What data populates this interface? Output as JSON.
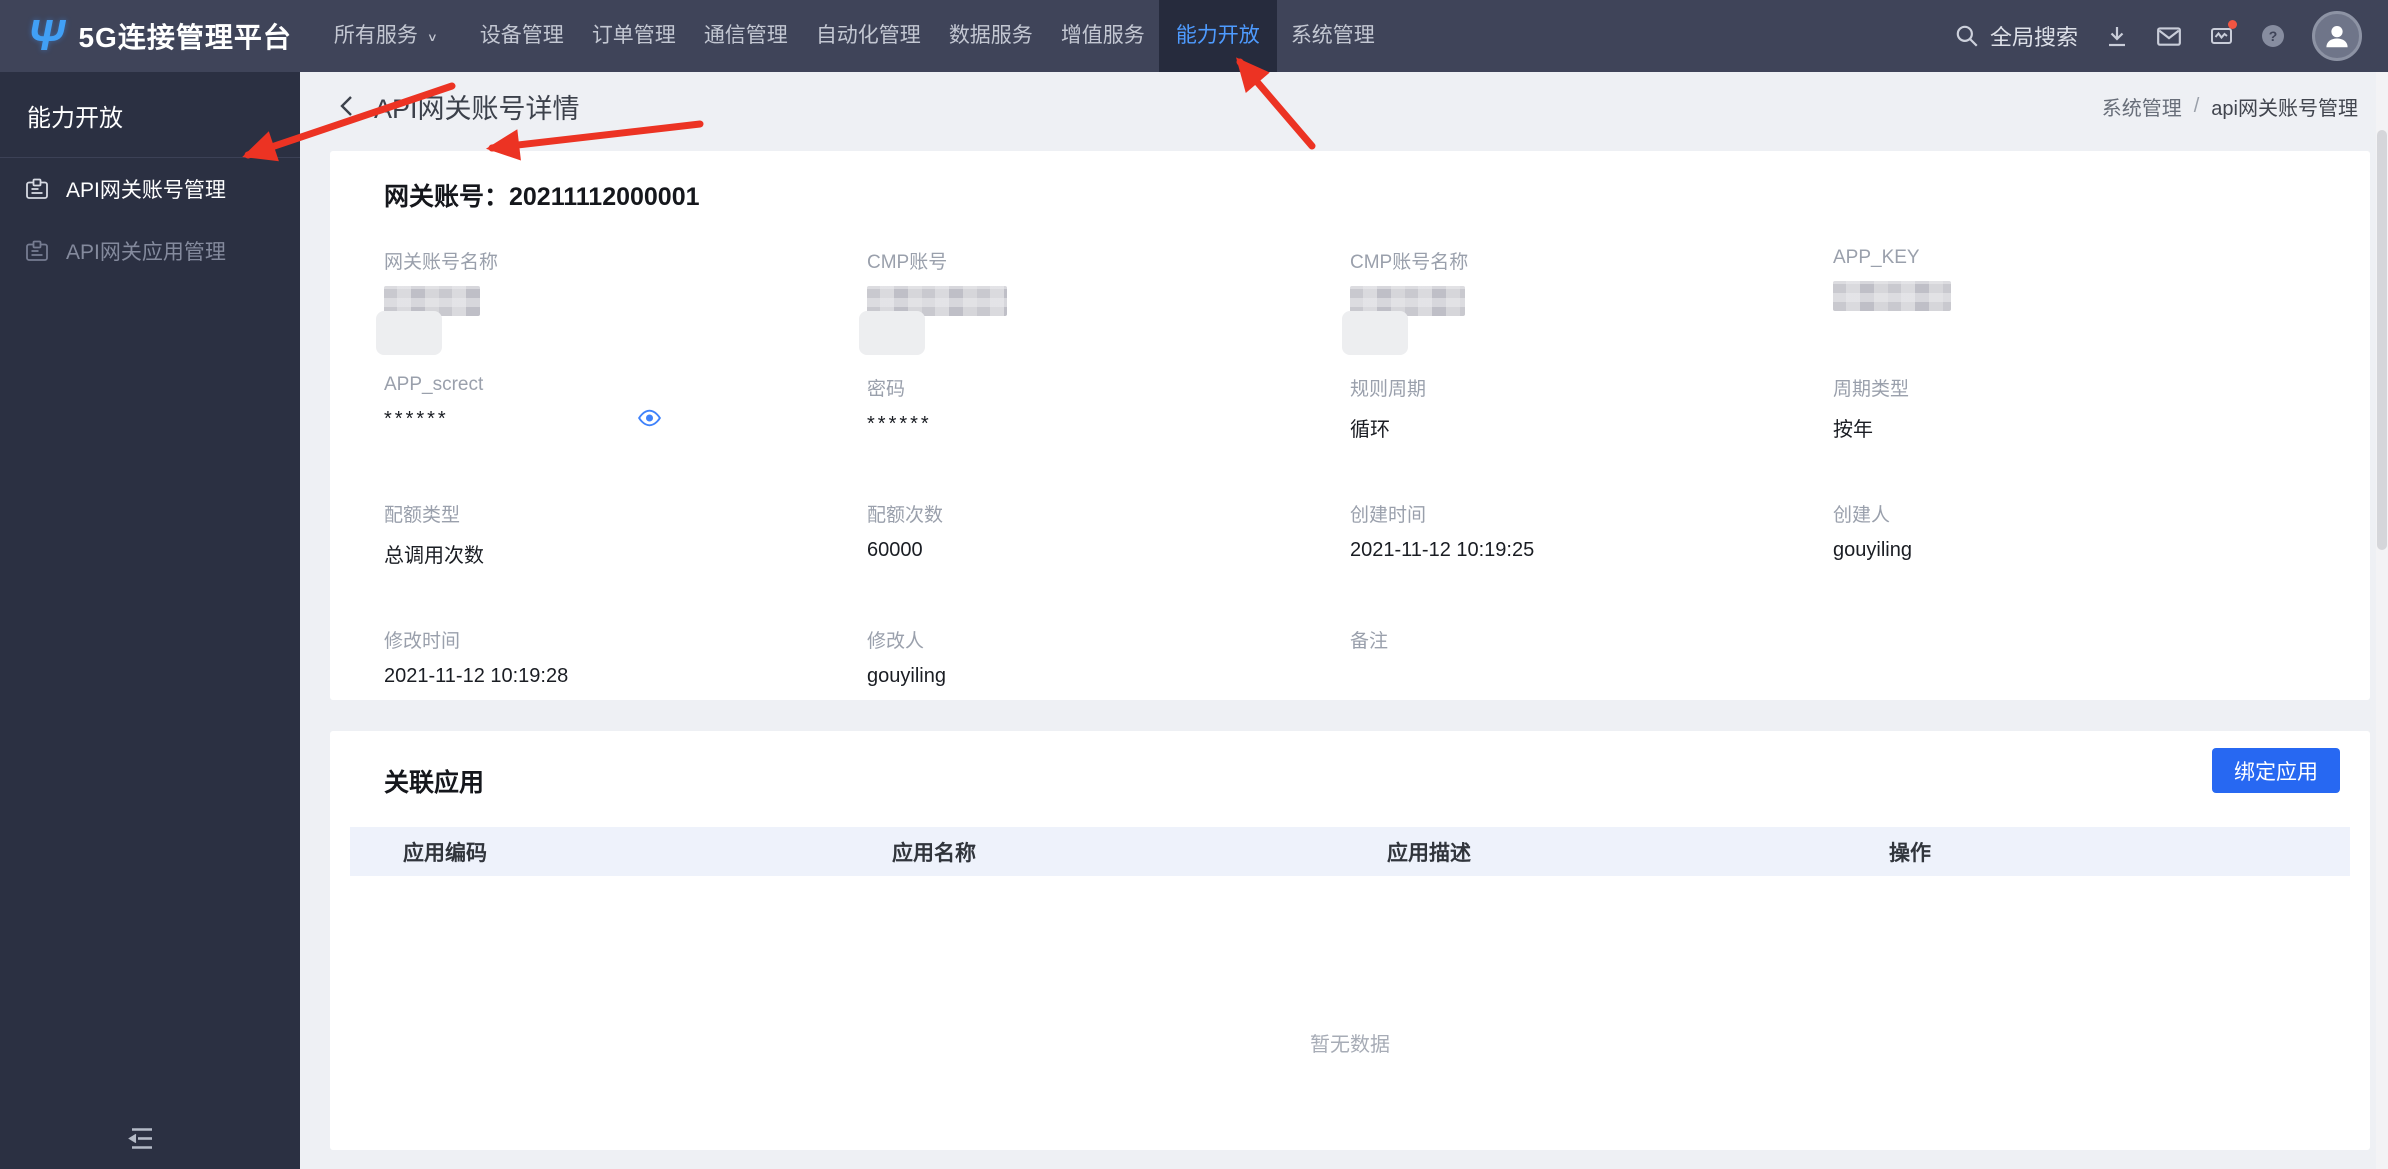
{
  "navbar": {
    "brand": "5G连接管理平台",
    "menu": [
      {
        "label": "所有服务",
        "active": false
      },
      {
        "label": "设备管理",
        "active": false
      },
      {
        "label": "订单管理",
        "active": false
      },
      {
        "label": "通信管理",
        "active": false
      },
      {
        "label": "自动化管理",
        "active": false
      },
      {
        "label": "数据服务",
        "active": false
      },
      {
        "label": "增值服务",
        "active": false
      },
      {
        "label": "能力开放",
        "active": true
      },
      {
        "label": "系统管理",
        "active": false
      }
    ],
    "dropdown_caret": "∨",
    "search_label": "全局搜索",
    "icons": [
      "search-icon",
      "download-icon",
      "mail-icon",
      "monitor-icon",
      "help-icon",
      "avatar"
    ],
    "notification_dot": true
  },
  "sidebar": {
    "header": "能力开放",
    "items": [
      {
        "label": "API网关账号管理",
        "active": true
      },
      {
        "label": "API网关应用管理",
        "active": false
      }
    ]
  },
  "page": {
    "title": "API网关账号详情",
    "breadcrumb": {
      "parent": "系统管理",
      "separator": "/",
      "current": "api网关账号管理"
    }
  },
  "detail": {
    "account_title": "网关账号：20211112000001",
    "fields": [
      {
        "label": "网关账号名称",
        "value": "",
        "redacted": true
      },
      {
        "label": "CMP账号",
        "value": "",
        "redacted": true
      },
      {
        "label": "CMP账号名称",
        "value": "",
        "redacted": true
      },
      {
        "label": "APP_KEY",
        "value": "",
        "redacted": true
      },
      {
        "label": "APP_screct",
        "value": "******",
        "has_eye_toggle": true
      },
      {
        "label": "密码",
        "value": "******"
      },
      {
        "label": "规则周期",
        "value": "循环"
      },
      {
        "label": "周期类型",
        "value": "按年"
      },
      {
        "label": "配额类型",
        "value": "总调用次数"
      },
      {
        "label": "配额次数",
        "value": "60000"
      },
      {
        "label": "创建时间",
        "value": "2021-11-12 10:19:25"
      },
      {
        "label": "创建人",
        "value": "gouyiling"
      },
      {
        "label": "修改时间",
        "value": "2021-11-12 10:19:28"
      },
      {
        "label": "修改人",
        "value": "gouyiling"
      },
      {
        "label": "备注",
        "value": ""
      }
    ]
  },
  "related_apps": {
    "title": "关联应用",
    "bind_button": "绑定应用",
    "columns": [
      "应用编码",
      "应用名称",
      "应用描述",
      "操作"
    ],
    "empty_text": "暂无数据"
  },
  "colors": {
    "navbar_bg": "#3f4459",
    "navbar_active_bg": "#262b3d",
    "sidebar_bg": "#2b3042",
    "accent_blue": "#2768f2",
    "nav_active_text": "#4e9bff",
    "table_header_bg": "#eef2fb",
    "annotation_arrow": "#ec3323",
    "notification_dot": "#f25542"
  }
}
